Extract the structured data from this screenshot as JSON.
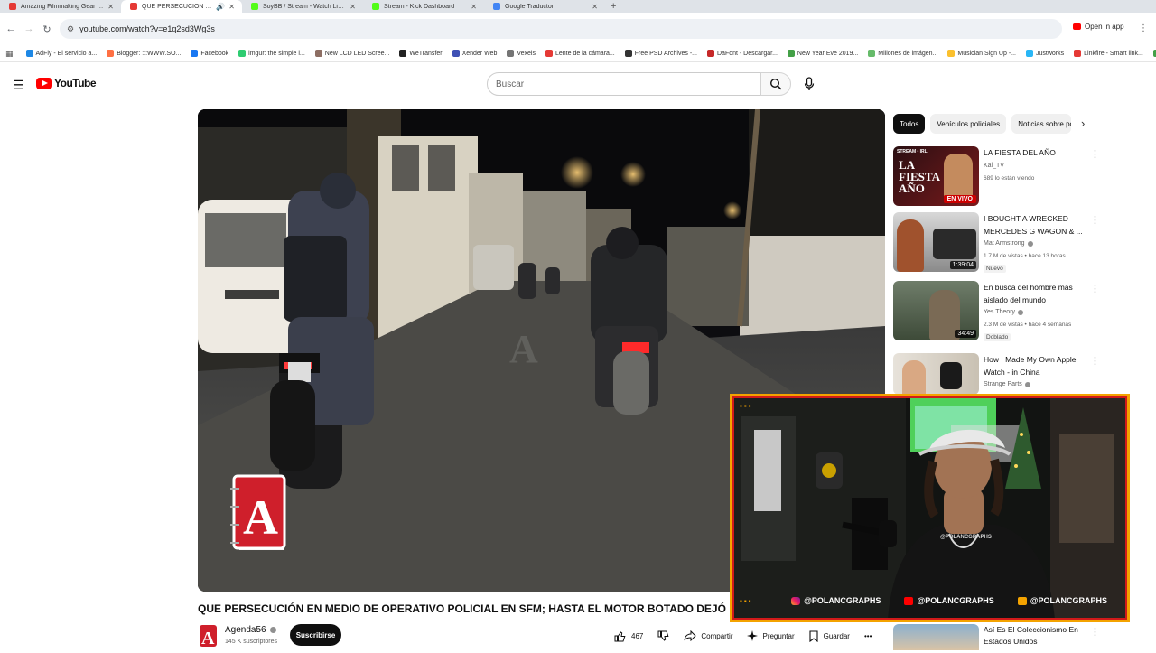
{
  "browser": {
    "tabs": [
      {
        "label": "Amazing Filmmaking Gear Und",
        "color": "#e53935"
      },
      {
        "label": "QUE PERSECUCIÓN EN ME",
        "color": "#e53935",
        "active": true
      },
      {
        "label": "SoyBB / Stream - Watch Live on",
        "color": "#53fc18"
      },
      {
        "label": "Stream - Kick Dashboard",
        "color": "#53fc18"
      },
      {
        "label": "Google Traductor",
        "color": "#4285f4"
      }
    ],
    "new_tab": "+",
    "url": "youtube.com/watch?v=e1q2sd3Wg3s",
    "open_in_app": "Open in app",
    "bookmarks": [
      {
        "label": "AdFly - El servicio a...",
        "color": "#1e88e5"
      },
      {
        "label": "Blogger: :::WWW.SO...",
        "color": "#ff7043"
      },
      {
        "label": "Facebook",
        "color": "#1877f2"
      },
      {
        "label": "imgur: the simple i...",
        "color": "#2ecc71"
      },
      {
        "label": "New LCD LED Scree...",
        "color": "#8d6e63"
      },
      {
        "label": "WeTransfer",
        "color": "#222222"
      },
      {
        "label": "Xender Web",
        "color": "#3f51b5"
      },
      {
        "label": "Vexels",
        "color": "#757575"
      },
      {
        "label": "Lente de la cámara...",
        "color": "#e53935"
      },
      {
        "label": "Free PSD Archives -...",
        "color": "#333333"
      },
      {
        "label": "DaFont - Descargar...",
        "color": "#c62828"
      },
      {
        "label": "New Year Eve 2019...",
        "color": "#43a047"
      },
      {
        "label": "Millones de imágen...",
        "color": "#66bb6a"
      },
      {
        "label": "Musician Sign Up -...",
        "color": "#fbc02d"
      },
      {
        "label": "Justworks",
        "color": "#29b6f6"
      },
      {
        "label": "Linkfire - Smart link...",
        "color": "#e53935"
      },
      {
        "label": "Descarga",
        "color": "#43a047"
      }
    ]
  },
  "youtube": {
    "logo_text": "YouTube",
    "search_placeholder": "Buscar",
    "video": {
      "title": "QUE PERSECUCIÓN EN MEDIO DE OPERATIVO POLICIAL EN SFM; HASTA EL MOTOR BOTADO DEJÓ",
      "channel": "Agenda56",
      "subscribers": "145 K suscriptores",
      "subscribe_label": "Suscribirse",
      "likes": "467",
      "share_label": "Compartir",
      "ask_label": "Preguntar",
      "save_label": "Guardar",
      "more_label": "•••"
    },
    "chips": [
      "Todos",
      "Vehículos policiales",
      "Noticias sobre po"
    ],
    "recommendations": [
      {
        "title": "LA FIESTA DEL AÑO",
        "channel": "Kai_TV",
        "meta": "689 lo están viendo",
        "badge": "",
        "overlay": "EN VIVO",
        "live": true,
        "thumb_text": "LA FIESTA AÑO",
        "thumb_tag": "STREAM • IRL",
        "verified": false
      },
      {
        "title": "I BOUGHT A WRECKED MERCEDES G WAGON & ...",
        "channel": "Mat Armstrong",
        "meta": "1.7 M de vistas • hace 13 horas",
        "badge": "Nuevo",
        "overlay": "1:39:04",
        "live": false,
        "verified": true
      },
      {
        "title": "En busca del hombre más aislado del mundo",
        "channel": "Yes Theory",
        "meta": "2.3 M de vistas • hace 4 semanas",
        "badge": "Doblado",
        "overlay": "34:49",
        "live": false,
        "verified": true
      },
      {
        "title": "How I Made My Own Apple Watch - in China",
        "channel": "Strange Parts",
        "meta": "",
        "badge": "",
        "overlay": "",
        "live": false,
        "verified": true
      },
      {
        "title": "Así Es El Coleccionismo En Estados Unidos",
        "channel": "",
        "meta": "",
        "badge": "",
        "overlay": "",
        "live": false,
        "verified": false
      }
    ]
  },
  "webcam": {
    "handles": [
      "@POLANCGRAPHS",
      "@POLANCGRAPHS",
      "@POLANCGRAPHS"
    ],
    "networks": [
      "instagram-icon",
      "youtube-icon",
      "facebook-icon"
    ],
    "shirt_text": "@POLANCGRAPHS"
  },
  "video_watermark": "A",
  "colors": {
    "accent": "#ff0000",
    "frame_orange": "#f4a300",
    "frame_red": "#d11a1a"
  }
}
